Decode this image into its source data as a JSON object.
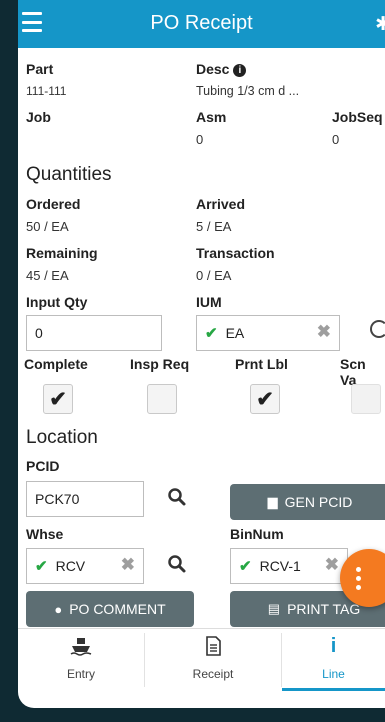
{
  "header": {
    "title": "PO Receipt"
  },
  "fields": {
    "part_label": "Part",
    "part_value": "111-111",
    "desc_label": "Desc",
    "desc_value": "Tubing 1/3 cm d ...",
    "job_label": "Job",
    "asm_label": "Asm",
    "asm_value": "0",
    "jobseq_label": "JobSeq",
    "jobseq_value": "0"
  },
  "quantities": {
    "section_title": "Quantities",
    "ordered_label": "Ordered",
    "ordered_value": "50 / EA",
    "arrived_label": "Arrived",
    "arrived_value": "5 / EA",
    "remaining_label": "Remaining",
    "remaining_value": "45 / EA",
    "transaction_label": "Transaction",
    "transaction_value": "0 / EA",
    "input_qty_label": "Input Qty",
    "input_qty_value": "0",
    "ium_label": "IUM",
    "ium_value": "EA"
  },
  "checks": {
    "complete_label": "Complete",
    "complete_checked": true,
    "insp_req_label": "Insp Req",
    "insp_req_checked": false,
    "prnt_lbl_label": "Prnt Lbl",
    "prnt_lbl_checked": true,
    "scn_val_label": "Scn Va",
    "scn_val_checked": false
  },
  "location": {
    "section_title": "Location",
    "pcid_label": "PCID",
    "pcid_value": "PCK70",
    "gen_pcid_label": "GEN PCID",
    "whse_label": "Whse",
    "whse_value": "RCV",
    "binnum_label": "BinNum",
    "binnum_value": "RCV-1"
  },
  "actions": {
    "po_comment_label": "PO COMMENT",
    "print_tag_label": "PRINT TAG"
  },
  "tabs": [
    {
      "label": "Entry",
      "icon": "ship-icon"
    },
    {
      "label": "Receipt",
      "icon": "receipt-icon"
    },
    {
      "label": "Line",
      "icon": "info-icon",
      "active": true
    }
  ],
  "colors": {
    "header": "#1596c8",
    "button": "#5d6e73",
    "fab": "#f47a20",
    "check": "#27a744"
  }
}
